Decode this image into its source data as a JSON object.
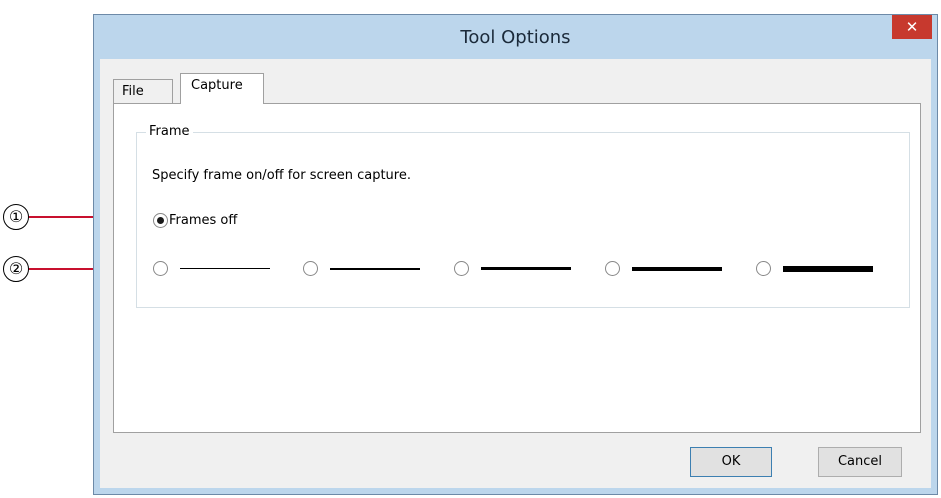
{
  "dialog": {
    "title": "Tool Options",
    "close_glyph": "✕"
  },
  "tabs": [
    {
      "label": "File"
    },
    {
      "label": "Capture",
      "selected": true
    }
  ],
  "frame_group": {
    "label": "Frame",
    "description": "Specify frame on/off for screen capture.",
    "frames_off_label": "Frames off",
    "frames_off_selected": true,
    "line_weight_options": 5
  },
  "buttons": {
    "ok": "OK",
    "cancel": "Cancel"
  },
  "callouts": [
    "①",
    "②"
  ],
  "colors": {
    "callout_line": "#c8102e",
    "title_bar": "#bcd6ec",
    "close_button": "#c7392e"
  }
}
